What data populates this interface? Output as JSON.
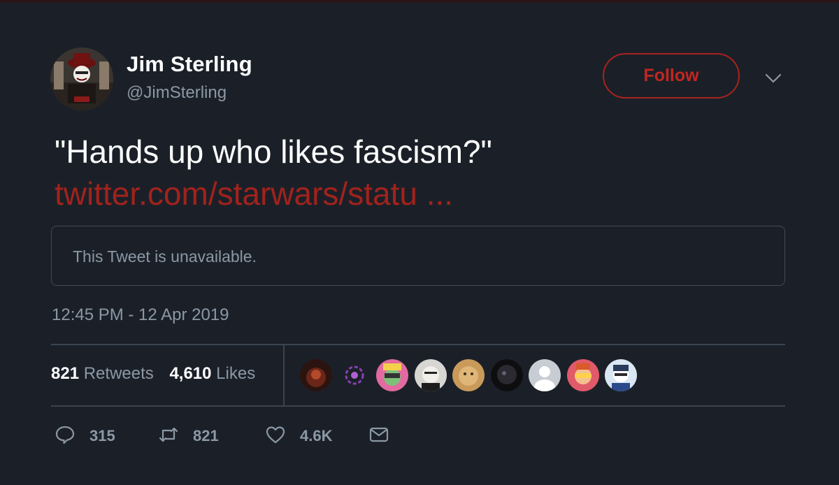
{
  "tweet": {
    "author_name": "Jim Sterling",
    "author_handle": "@JimSterling",
    "follow_label": "Follow",
    "text": "\"Hands up who likes fascism?\"",
    "link_text": "twitter.com/starwars/statu ...",
    "quoted_unavailable": "This Tweet is unavailable.",
    "timestamp": "12:45 PM - 12 Apr 2019"
  },
  "stats": {
    "retweets_count": "821",
    "retweets_label": "Retweets",
    "likes_count": "4,610",
    "likes_label": "Likes"
  },
  "actions": {
    "replies": "315",
    "retweets": "821",
    "likes": "4.6K"
  },
  "colors": {
    "background": "#1b2028",
    "accent": "#a2221c",
    "secondary_text": "#8b98a5",
    "divider": "#3b4450"
  },
  "icons": {
    "reply": "reply-icon",
    "retweet": "retweet-icon",
    "like": "heart-icon",
    "dm": "envelope-icon",
    "more": "chevron-down-icon"
  }
}
